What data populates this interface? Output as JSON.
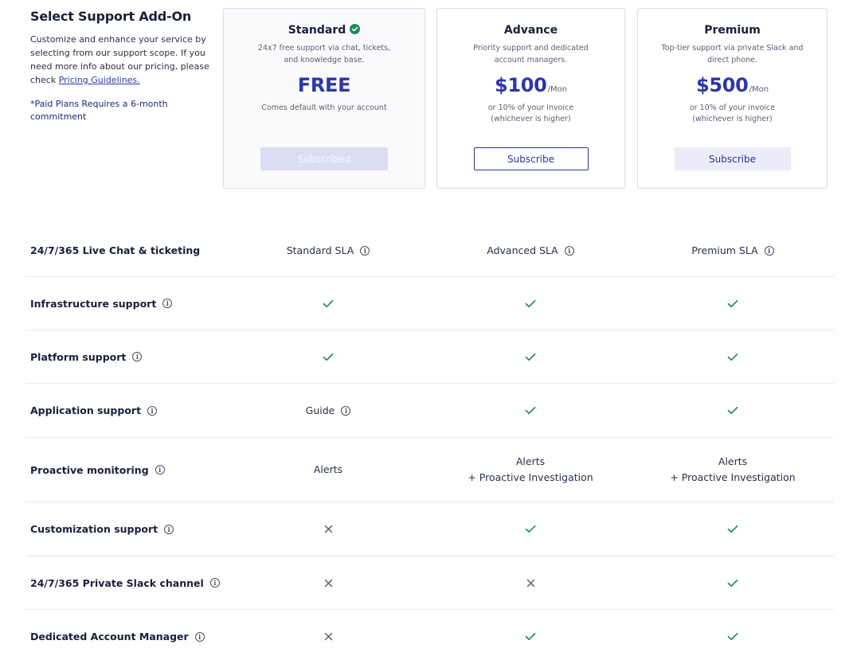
{
  "intro": {
    "title": "Select Support Add-On",
    "description": "Customize and enhance your service by selecting from our support scope. If you need more info about our pricing, please check ",
    "link_label": "Pricing Guidelines.",
    "note": "*Paid Plans Requires a 6-month commitment"
  },
  "plans": [
    {
      "name": "Standard",
      "badge_icon": "check-circle-icon",
      "description": "24x7 free support via chat, tickets, and knowledge base.",
      "price": "FREE",
      "period": "",
      "price_note": "Comes default with your account",
      "button_label": "Subscribed",
      "button_state": "disabled"
    },
    {
      "name": "Advance",
      "description": "Priority support and dedicated account managers.",
      "price": "$100",
      "period": "/Mon",
      "price_note": "or 10% of your invoice (whichever is higher)",
      "button_label": "Subscribe"
    },
    {
      "name": "Premium",
      "description": "Top-tier support via private Slack and direct phone.",
      "price": "$500",
      "period": "/Mon",
      "price_note": "or 10% of your invoice (whichever is higher)",
      "button_label": "Subscribe"
    }
  ],
  "colors": {
    "accent": "#2d36a8",
    "check": "#1f8a5b",
    "cross": "#5b5e72",
    "badge": "#1f8a5b"
  },
  "features": [
    {
      "label": "24/7/365 Live Chat & ticketing",
      "info": false,
      "standard": {
        "text": "Standard SLA",
        "info": true
      },
      "advance": {
        "text": "Advanced SLA",
        "info": true
      },
      "premium": {
        "text": "Premium SLA",
        "info": true
      }
    },
    {
      "label": "Infrastructure support",
      "info": true,
      "standard": {
        "icon": "check"
      },
      "advance": {
        "icon": "check"
      },
      "premium": {
        "icon": "check"
      }
    },
    {
      "label": "Platform support",
      "info": true,
      "standard": {
        "icon": "check"
      },
      "advance": {
        "icon": "check"
      },
      "premium": {
        "icon": "check"
      }
    },
    {
      "label": "Application support",
      "info": true,
      "standard": {
        "text": "Guide",
        "info": true
      },
      "advance": {
        "icon": "check"
      },
      "premium": {
        "icon": "check"
      }
    },
    {
      "label": "Proactive monitoring",
      "info": true,
      "standard": {
        "text": "Alerts"
      },
      "advance": {
        "text": "Alerts",
        "text2": "+ Proactive Investigation"
      },
      "premium": {
        "text": "Alerts",
        "text2": "+ Proactive Investigation"
      }
    },
    {
      "label": "Customization support",
      "info": true,
      "standard": {
        "icon": "cross"
      },
      "advance": {
        "icon": "check"
      },
      "premium": {
        "icon": "check"
      }
    },
    {
      "label": "24/7/365 Private Slack channel",
      "info": true,
      "standard": {
        "icon": "cross"
      },
      "advance": {
        "icon": "cross"
      },
      "premium": {
        "icon": "check"
      }
    },
    {
      "label": "Dedicated Account Manager",
      "info": true,
      "standard": {
        "icon": "cross"
      },
      "advance": {
        "icon": "check"
      },
      "premium": {
        "icon": "check"
      }
    }
  ]
}
